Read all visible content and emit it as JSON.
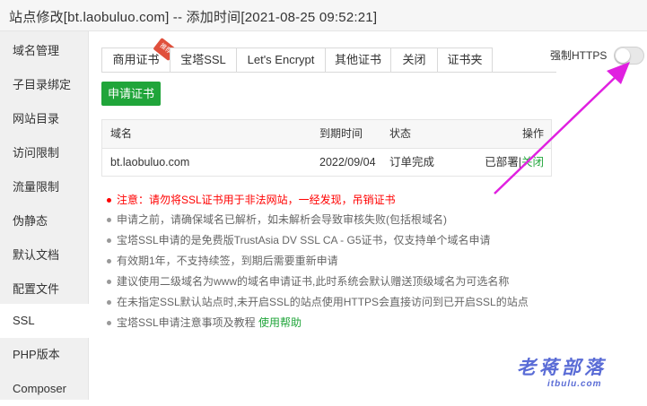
{
  "window": {
    "title": "站点修改[bt.laobuluo.com] -- 添加时间[2021-08-25 09:52:21]"
  },
  "sidebar": {
    "items": [
      {
        "label": "域名管理"
      },
      {
        "label": "子目录绑定"
      },
      {
        "label": "网站目录"
      },
      {
        "label": "访问限制"
      },
      {
        "label": "流量限制"
      },
      {
        "label": "伪静态"
      },
      {
        "label": "默认文档"
      },
      {
        "label": "配置文件"
      },
      {
        "label": "SSL"
      },
      {
        "label": "PHP版本"
      },
      {
        "label": "Composer"
      }
    ],
    "active": "SSL"
  },
  "tabs": [
    {
      "label": "商用证书",
      "badge": "推荐"
    },
    {
      "label": "宝塔SSL"
    },
    {
      "label": "Let's Encrypt"
    },
    {
      "label": "其他证书"
    },
    {
      "label": "关闭"
    },
    {
      "label": "证书夹"
    }
  ],
  "active_tab": "宝塔SSL",
  "force_https": {
    "label": "强制HTTPS",
    "enabled": false
  },
  "apply_button": "申请证书",
  "table": {
    "headers": [
      "域名",
      "到期时间",
      "状态",
      "操作"
    ],
    "rows": [
      {
        "domain": "bt.laobuluo.com",
        "expire": "2022/09/04",
        "status": "订单完成",
        "deployed": "已部署",
        "separator": "|",
        "action": "关闭"
      }
    ]
  },
  "notes": [
    {
      "text": "注意：请勿将SSL证书用于非法网站，一经发现，吊销证书",
      "warning": true
    },
    {
      "text": "申请之前，请确保域名已解析，如未解析会导致审核失败(包括根域名)"
    },
    {
      "text": "宝塔SSL申请的是免费版TrustAsia DV SSL CA - G5证书，仅支持单个域名申请"
    },
    {
      "text": "有效期1年，不支持续签，到期后需要重新申请"
    },
    {
      "text": "建议使用二级域名为www的域名申请证书,此时系统会默认赠送顶级域名为可选名称"
    },
    {
      "text": "在未指定SSL默认站点时,未开启SSL的站点使用HTTPS会直接访问到已开启SSL的站点"
    },
    {
      "text": "宝塔SSL申请注意事项及教程",
      "link": "使用帮助"
    }
  ],
  "watermark": {
    "main": "老蒋部落",
    "sub": "itbulu.com"
  },
  "colors": {
    "accent": "#20a53a",
    "warning": "#ff0000",
    "annotation_arrow": "#e020e0",
    "watermark": "#5a6cd6"
  }
}
